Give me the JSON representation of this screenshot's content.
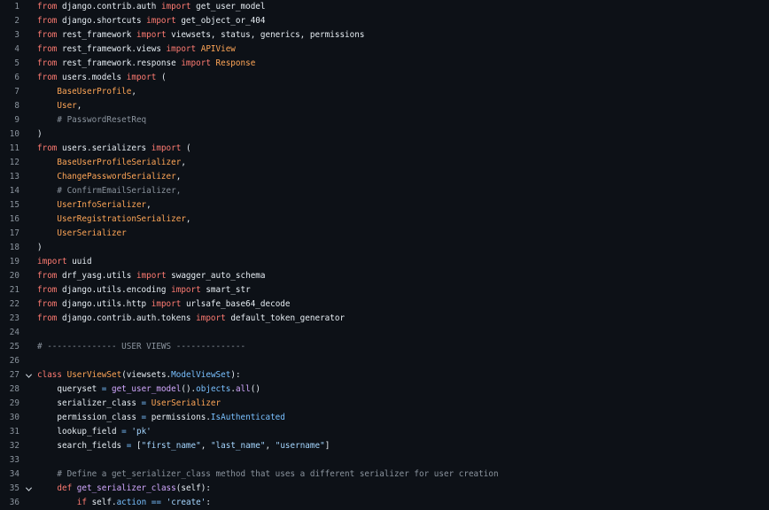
{
  "editor": {
    "lines": [
      {
        "n": "1",
        "fold": false,
        "tokens": [
          [
            "kw",
            "from"
          ],
          [
            "t",
            " django.contrib.auth "
          ],
          [
            "kw",
            "import"
          ],
          [
            "t",
            " get_user_model"
          ]
        ]
      },
      {
        "n": "2",
        "fold": false,
        "tokens": [
          [
            "kw",
            "from"
          ],
          [
            "t",
            " django.shortcuts "
          ],
          [
            "kw",
            "import"
          ],
          [
            "t",
            " get_object_or_404"
          ]
        ]
      },
      {
        "n": "3",
        "fold": false,
        "tokens": [
          [
            "kw",
            "from"
          ],
          [
            "t",
            " rest_framework "
          ],
          [
            "kw",
            "import"
          ],
          [
            "t",
            " viewsets, status, generics, permissions"
          ]
        ]
      },
      {
        "n": "4",
        "fold": false,
        "tokens": [
          [
            "kw",
            "from"
          ],
          [
            "t",
            " rest_framework.views "
          ],
          [
            "kw",
            "import"
          ],
          [
            "cls",
            " APIView"
          ]
        ]
      },
      {
        "n": "5",
        "fold": false,
        "tokens": [
          [
            "kw",
            "from"
          ],
          [
            "t",
            " rest_framework.response "
          ],
          [
            "kw",
            "import"
          ],
          [
            "cls",
            " Response"
          ]
        ]
      },
      {
        "n": "6",
        "fold": false,
        "tokens": [
          [
            "kw",
            "from"
          ],
          [
            "t",
            " users.models "
          ],
          [
            "kw",
            "import"
          ],
          [
            "t",
            " ("
          ]
        ]
      },
      {
        "n": "7",
        "fold": false,
        "tokens": [
          [
            "t",
            "    "
          ],
          [
            "cls",
            "BaseUserProfile"
          ],
          [
            "t",
            ","
          ]
        ]
      },
      {
        "n": "8",
        "fold": false,
        "tokens": [
          [
            "t",
            "    "
          ],
          [
            "cls",
            "User"
          ],
          [
            "t",
            ","
          ]
        ]
      },
      {
        "n": "9",
        "fold": false,
        "tokens": [
          [
            "t",
            "    "
          ],
          [
            "cm",
            "# PasswordResetReq"
          ]
        ]
      },
      {
        "n": "10",
        "fold": false,
        "tokens": [
          [
            "t",
            ")"
          ]
        ]
      },
      {
        "n": "11",
        "fold": false,
        "tokens": [
          [
            "kw",
            "from"
          ],
          [
            "t",
            " users.serializers "
          ],
          [
            "kw",
            "import"
          ],
          [
            "t",
            " ("
          ]
        ]
      },
      {
        "n": "12",
        "fold": false,
        "tokens": [
          [
            "t",
            "    "
          ],
          [
            "cls",
            "BaseUserProfileSerializer"
          ],
          [
            "t",
            ","
          ]
        ]
      },
      {
        "n": "13",
        "fold": false,
        "tokens": [
          [
            "t",
            "    "
          ],
          [
            "cls",
            "ChangePasswordSerializer"
          ],
          [
            "t",
            ","
          ]
        ]
      },
      {
        "n": "14",
        "fold": false,
        "tokens": [
          [
            "t",
            "    "
          ],
          [
            "cm",
            "# ConfirmEmailSerializer,"
          ]
        ]
      },
      {
        "n": "15",
        "fold": false,
        "tokens": [
          [
            "t",
            "    "
          ],
          [
            "cls",
            "UserInfoSerializer"
          ],
          [
            "t",
            ","
          ]
        ]
      },
      {
        "n": "16",
        "fold": false,
        "tokens": [
          [
            "t",
            "    "
          ],
          [
            "cls",
            "UserRegistrationSerializer"
          ],
          [
            "t",
            ","
          ]
        ]
      },
      {
        "n": "17",
        "fold": false,
        "tokens": [
          [
            "t",
            "    "
          ],
          [
            "cls",
            "UserSerializer"
          ]
        ]
      },
      {
        "n": "18",
        "fold": false,
        "tokens": [
          [
            "t",
            ")"
          ]
        ]
      },
      {
        "n": "19",
        "fold": false,
        "tokens": [
          [
            "kw",
            "import"
          ],
          [
            "t",
            " uuid"
          ]
        ]
      },
      {
        "n": "20",
        "fold": false,
        "tokens": [
          [
            "kw",
            "from"
          ],
          [
            "t",
            " drf_yasg.utils "
          ],
          [
            "kw",
            "import"
          ],
          [
            "t",
            " swagger_auto_schema"
          ]
        ]
      },
      {
        "n": "21",
        "fold": false,
        "tokens": [
          [
            "kw",
            "from"
          ],
          [
            "t",
            " django.utils.encoding "
          ],
          [
            "kw",
            "import"
          ],
          [
            "t",
            " smart_str"
          ]
        ]
      },
      {
        "n": "22",
        "fold": false,
        "tokens": [
          [
            "kw",
            "from"
          ],
          [
            "t",
            " django.utils.http "
          ],
          [
            "kw",
            "import"
          ],
          [
            "t",
            " urlsafe_base64_decode"
          ]
        ]
      },
      {
        "n": "23",
        "fold": false,
        "tokens": [
          [
            "kw",
            "from"
          ],
          [
            "t",
            " django.contrib.auth.tokens "
          ],
          [
            "kw",
            "import"
          ],
          [
            "t",
            " default_token_generator"
          ]
        ]
      },
      {
        "n": "24",
        "fold": false,
        "tokens": []
      },
      {
        "n": "25",
        "fold": false,
        "tokens": [
          [
            "cm",
            "# -------------- USER VIEWS --------------"
          ]
        ]
      },
      {
        "n": "26",
        "fold": false,
        "tokens": []
      },
      {
        "n": "27",
        "fold": true,
        "tokens": [
          [
            "kw",
            "class"
          ],
          [
            "t",
            " "
          ],
          [
            "cls",
            "UserViewSet"
          ],
          [
            "t",
            "(viewsets."
          ],
          [
            "attr",
            "ModelViewSet"
          ],
          [
            "t",
            "):"
          ]
        ]
      },
      {
        "n": "28",
        "fold": false,
        "tokens": [
          [
            "t",
            "    queryset "
          ],
          [
            "op",
            "="
          ],
          [
            "t",
            " "
          ],
          [
            "fn",
            "get_user_model"
          ],
          [
            "t",
            "()."
          ],
          [
            "attr",
            "objects"
          ],
          [
            "t",
            "."
          ],
          [
            "fn",
            "all"
          ],
          [
            "t",
            "()"
          ]
        ]
      },
      {
        "n": "29",
        "fold": false,
        "tokens": [
          [
            "t",
            "    serializer_class "
          ],
          [
            "op",
            "="
          ],
          [
            "t",
            " "
          ],
          [
            "cls",
            "UserSerializer"
          ]
        ]
      },
      {
        "n": "30",
        "fold": false,
        "tokens": [
          [
            "t",
            "    permission_class "
          ],
          [
            "op",
            "="
          ],
          [
            "t",
            " permissions."
          ],
          [
            "attr",
            "IsAuthenticated"
          ]
        ]
      },
      {
        "n": "31",
        "fold": false,
        "tokens": [
          [
            "t",
            "    lookup_field "
          ],
          [
            "op",
            "="
          ],
          [
            "t",
            " "
          ],
          [
            "str",
            "'pk'"
          ]
        ]
      },
      {
        "n": "32",
        "fold": false,
        "tokens": [
          [
            "t",
            "    search_fields "
          ],
          [
            "op",
            "="
          ],
          [
            "t",
            " ["
          ],
          [
            "str",
            "\"first_name\""
          ],
          [
            "t",
            ", "
          ],
          [
            "str",
            "\"last_name\""
          ],
          [
            "t",
            ", "
          ],
          [
            "str",
            "\"username\""
          ],
          [
            "t",
            "]"
          ]
        ]
      },
      {
        "n": "33",
        "fold": false,
        "tokens": []
      },
      {
        "n": "34",
        "fold": false,
        "tokens": [
          [
            "t",
            "    "
          ],
          [
            "cm",
            "# Define a get_serializer_class method that uses a different serializer for user creation"
          ]
        ]
      },
      {
        "n": "35",
        "fold": true,
        "tokens": [
          [
            "t",
            "    "
          ],
          [
            "kw",
            "def"
          ],
          [
            "t",
            " "
          ],
          [
            "fn",
            "get_serializer_class"
          ],
          [
            "t",
            "(self):"
          ]
        ]
      },
      {
        "n": "36",
        "fold": false,
        "tokens": [
          [
            "t",
            "        "
          ],
          [
            "kw",
            "if"
          ],
          [
            "t",
            " self."
          ],
          [
            "attr",
            "action"
          ],
          [
            "t",
            " "
          ],
          [
            "op",
            "=="
          ],
          [
            "t",
            " "
          ],
          [
            "str",
            "'create'"
          ],
          [
            "t",
            ":"
          ]
        ]
      }
    ]
  },
  "colors": {
    "background": "#0d1117",
    "keyword": "#ff7b72",
    "class": "#ffa657",
    "comment": "#8b949e",
    "string": "#a5d6ff",
    "operator": "#79c0ff",
    "function": "#d2a8ff"
  },
  "icons": {
    "fold": "chevron-down-icon"
  }
}
